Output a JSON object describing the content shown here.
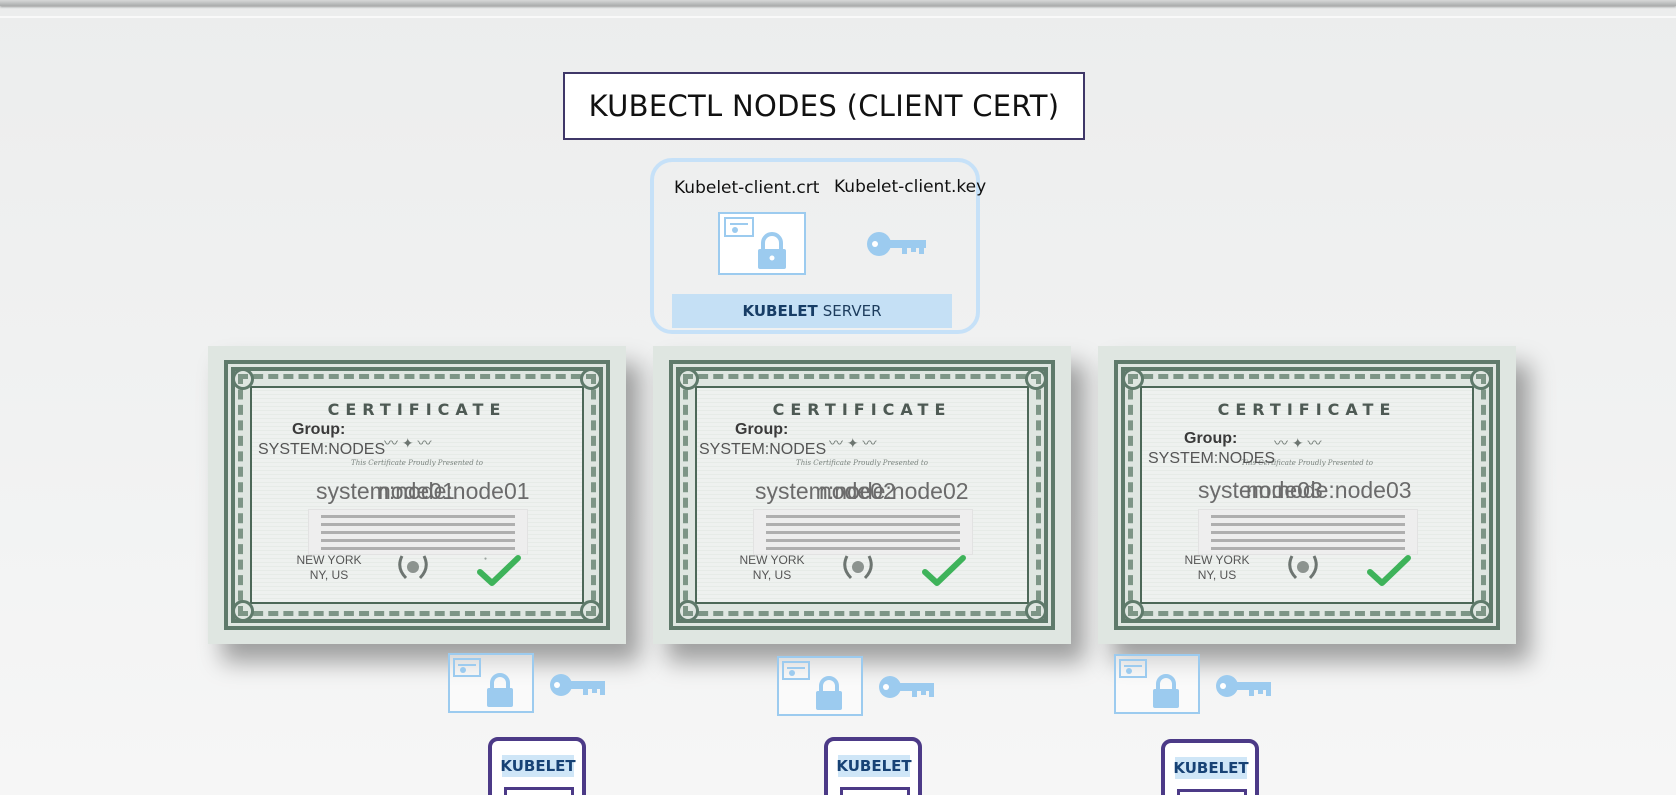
{
  "title": "KUBECTL NODES (CLIENT CERT)",
  "server": {
    "crt_label": "Kubelet-client.crt",
    "key_label": "Kubelet-client.key",
    "bar_bold": "KUBELET",
    "bar_rest": "SERVER"
  },
  "certificates": [
    {
      "heading": "CERTIFICATE",
      "group_label": "Group:",
      "group_value": "SYSTEM:NODES",
      "presented": "This Certificate Proudly Presented to",
      "subject": "system:node:node01",
      "node_name": "node01",
      "city": "NEW YORK",
      "state": "NY, US"
    },
    {
      "heading": "CERTIFICATE",
      "group_label": "Group:",
      "group_value": "SYSTEM:NODES",
      "presented": "This Certificate Proudly Presented to",
      "subject": "system:node:node02",
      "node_name": "node02",
      "city": "NEW YORK",
      "state": "NY, US"
    },
    {
      "heading": "CERTIFICATE",
      "group_label": "Group:",
      "group_value": "SYSTEM:NODES",
      "presented": "This Certificate Proudly Presented to",
      "subject": "system:node:node03",
      "node_name": "node03",
      "city": "NEW YORK",
      "state": "NY, US"
    }
  ],
  "nodes": [
    {
      "kubelet_label": "KUBELET"
    },
    {
      "kubelet_label": "KUBELET"
    },
    {
      "kubelet_label": "KUBELET"
    }
  ],
  "icons": {
    "certificate": "certificate-lock-icon",
    "key": "key-icon",
    "wreath": "laurel-wreath-icon",
    "check": "green-check-icon"
  },
  "colors": {
    "light_blue": "#9ccbef",
    "kubelet_purple": "#4c3a87",
    "check_green": "#3eb35a"
  }
}
